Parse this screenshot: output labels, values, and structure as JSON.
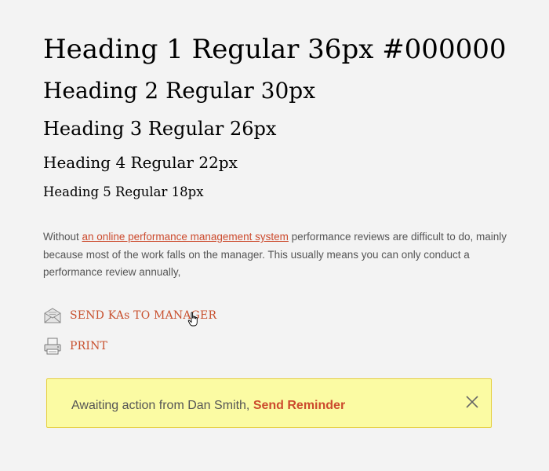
{
  "headings": {
    "h1": "Heading 1 Regular 36px #000000",
    "h2": "Heading 2 Regular 30px",
    "h3": "Heading 3 Regular 26px",
    "h4": "Heading 4 Regular 22px",
    "h5": "Heading 5 Regular 18px"
  },
  "paragraph": {
    "before_link": "Without ",
    "link_text": "an online performance management system",
    "after_link": " performance reviews are difficult to do, mainly because most of the work falls on the manager. This usually means you can only conduct a performance review annually,"
  },
  "actions": {
    "send": {
      "label": "SEND KAs TO MANAGER",
      "icon": "envelope-icon"
    },
    "print": {
      "label": "PRINT",
      "icon": "printer-icon"
    }
  },
  "alert": {
    "message": "Awaiting action from Dan Smith, ",
    "link": "Send Reminder",
    "close_icon": "close-icon"
  },
  "colors": {
    "accent": "#cc4b2e",
    "alert_bg": "#fbfba3",
    "alert_border": "#e6cf3c",
    "page_bg": "#f3f3f3"
  }
}
